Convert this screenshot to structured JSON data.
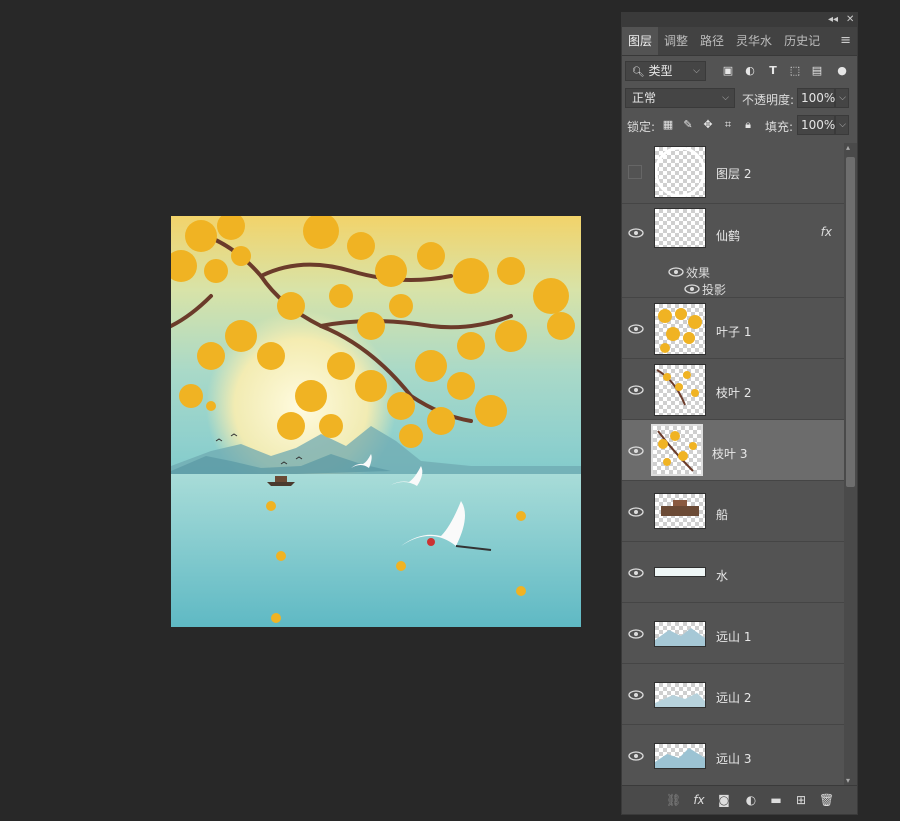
{
  "panel": {
    "tabs": [
      {
        "label": "图层",
        "active": true
      },
      {
        "label": "调整"
      },
      {
        "label": "路径"
      },
      {
        "label": "灵华水"
      },
      {
        "label": "历史记"
      }
    ],
    "filter": {
      "label": "类型"
    },
    "blend_mode": "正常",
    "opacity_label": "不透明度:",
    "opacity_value": "100%",
    "lock_label": "锁定:",
    "fill_label": "填充:",
    "fill_value": "100%",
    "layers": [
      {
        "name": "图层 2",
        "visible": false
      },
      {
        "name": "仙鹤",
        "visible": true,
        "fx": "fx",
        "effects_label": "效果",
        "effect": "投影"
      },
      {
        "name": "叶子 1",
        "visible": true
      },
      {
        "name": "枝叶 2",
        "visible": true
      },
      {
        "name": "枝叶 3",
        "visible": true,
        "selected": true
      },
      {
        "name": "船",
        "visible": true
      },
      {
        "name": "水",
        "visible": true
      },
      {
        "name": "远山 1",
        "visible": true
      },
      {
        "name": "远山 2",
        "visible": true
      },
      {
        "name": "远山 3",
        "visible": true
      }
    ],
    "bottom_icons": [
      "link-icon",
      "fx-icon",
      "mask-icon",
      "adjustment-icon",
      "folder-icon",
      "new-layer-icon",
      "trash-icon"
    ]
  },
  "colors": {
    "app_bg": "#282828",
    "panel_bg": "#535353",
    "selected_layer": "#6c6c6c",
    "leaf": "#f0b323",
    "water": "#7cc8c9"
  }
}
